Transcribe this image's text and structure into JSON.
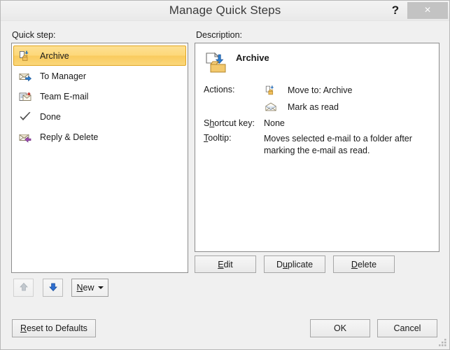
{
  "window": {
    "title": "Manage Quick Steps",
    "help_icon": "question-mark-icon",
    "help_label": "?",
    "close_label": "×",
    "background_color": "#f0f0f0",
    "title_color": "#3b3b3b",
    "close_button_color": "#c3c3c3"
  },
  "labels": {
    "quick_step": "Quick step:",
    "description": "Description:"
  },
  "quick_steps": {
    "selected_index": 0,
    "selection_color": "#fdd87a",
    "selection_border_color": "#e0a520",
    "items": [
      {
        "label": "Archive",
        "icon": "folder-move-icon",
        "selected": true
      },
      {
        "label": "To Manager",
        "icon": "envelope-forward-icon",
        "selected": false
      },
      {
        "label": "Team E-mail",
        "icon": "envelope-document-icon",
        "selected": false
      },
      {
        "label": "Done",
        "icon": "checkmark-icon",
        "selected": false
      },
      {
        "label": "Reply & Delete",
        "icon": "envelope-reply-delete-icon",
        "selected": false
      }
    ]
  },
  "description": {
    "icon": "archive-large-icon",
    "title": "Archive",
    "actions_label": "Actions:",
    "actions": [
      {
        "icon": "folder-move-icon",
        "text": "Move to: Archive"
      },
      {
        "icon": "envelope-open-icon",
        "text": "Mark as read"
      }
    ],
    "shortcut_label_prefix": "S",
    "shortcut_label_accel": "h",
    "shortcut_label_suffix": "ortcut key:",
    "shortcut_value": "None",
    "tooltip_label_accel": "T",
    "tooltip_label_suffix": "ooltip:",
    "tooltip_value": "Moves selected e-mail to a folder after marking the e-mail as read."
  },
  "detail_buttons": {
    "edit": {
      "accel": "E",
      "rest": "dit"
    },
    "duplicate": {
      "prefix": "D",
      "accel": "u",
      "rest": "plicate"
    },
    "delete": {
      "accel": "D",
      "rest": "elete"
    }
  },
  "list_toolbar": {
    "move_up": {
      "icon": "arrow-up-icon",
      "enabled": false,
      "color": "#b6bcc2"
    },
    "move_down": {
      "icon": "arrow-down-icon",
      "enabled": true,
      "color": "#2f6fd0"
    },
    "new": {
      "accel": "N",
      "rest": "ew",
      "icon": "chevron-down-icon"
    }
  },
  "footer_buttons": {
    "reset": {
      "accel": "R",
      "rest": "eset to Defaults"
    },
    "ok": "OK",
    "cancel": "Cancel"
  },
  "resize_grip": "resize-grip-icon"
}
